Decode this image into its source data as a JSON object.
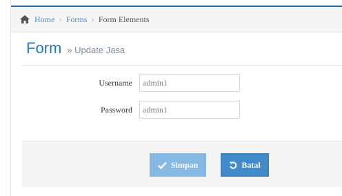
{
  "breadcrumb": {
    "home": "Home",
    "forms": "Forms",
    "current": "Form Elements",
    "separator": "›"
  },
  "header": {
    "title": "Form",
    "subtitle": "» Update Jasa"
  },
  "form": {
    "username": {
      "label": "Username",
      "value": "admin1"
    },
    "password": {
      "label": "Password",
      "value": "admin1"
    }
  },
  "actions": {
    "save_label": "Simpan",
    "cancel_label": "Batal"
  },
  "icons": {
    "home": "home-icon",
    "save": "check-icon",
    "cancel": "undo-icon"
  },
  "colors": {
    "accent": "#2679b5",
    "link": "#4c8fbd",
    "save_button": "#85b8e2",
    "cancel_button": "#428bca"
  }
}
